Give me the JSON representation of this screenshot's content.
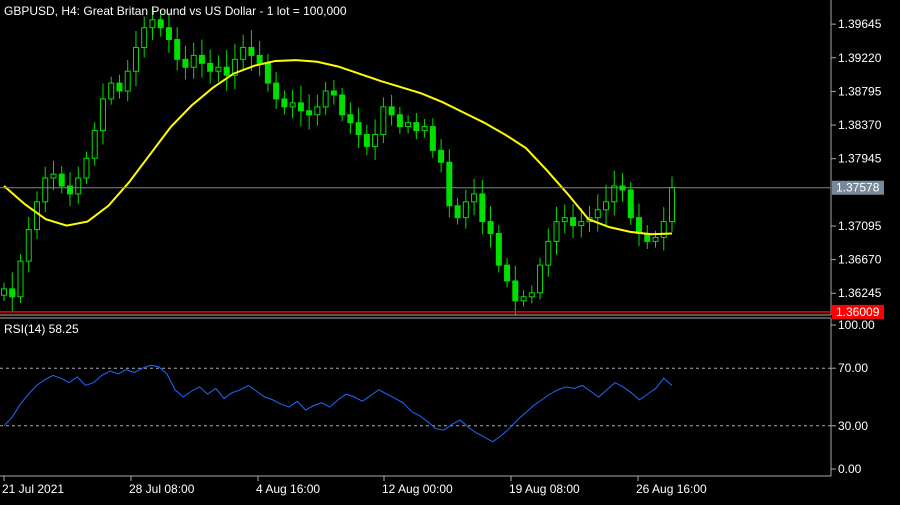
{
  "header": {
    "symbol_title": "GBPUSD, H4:  Great Britan Pound vs US Dollar - 1 lot = 100,000"
  },
  "colors": {
    "background": "#000000",
    "candle": "#00e000",
    "ma_line": "#ffff00",
    "rsi_line": "#1e6bff",
    "bid_line": "#778899",
    "alert_line": "#ff0000",
    "text": "#ffffff",
    "grid": "#aaaaaa"
  },
  "chart_data": [
    {
      "type": "candlestick",
      "title": "GBPUSD, H4:  Great Britan Pound vs US Dollar - 1 lot = 100,000",
      "ylim": [
        1.3597,
        1.3995
      ],
      "y_ticks": [
        "1.39645",
        "1.39220",
        "1.38795",
        "1.38370",
        "1.37945",
        "1.37095",
        "1.36670",
        "1.36245"
      ],
      "x_ticks": [
        "21 Jul 2021",
        "28 Jul 08:00",
        "4 Aug 16:00",
        "12 Aug 00:00",
        "19 Aug 08:00",
        "26 Aug 16:00"
      ],
      "current_price": "1.37578",
      "alert_price": "1.36009",
      "close_series": [
        1.363,
        1.362,
        1.3665,
        1.3705,
        1.374,
        1.377,
        1.3775,
        1.376,
        1.375,
        1.377,
        1.3795,
        1.383,
        1.387,
        1.389,
        1.388,
        1.3905,
        1.3935,
        1.396,
        1.397,
        1.396,
        1.3945,
        1.392,
        1.391,
        1.3925,
        1.3915,
        1.3905,
        1.391,
        1.39,
        1.392,
        1.3935,
        1.3925,
        1.3915,
        1.389,
        1.387,
        1.386,
        1.3865,
        1.3855,
        1.385,
        1.386,
        1.388,
        1.3875,
        1.385,
        1.384,
        1.3825,
        1.381,
        1.3825,
        1.386,
        1.385,
        1.3835,
        1.384,
        1.383,
        1.3835,
        1.3805,
        1.379,
        1.3735,
        1.372,
        1.374,
        1.375,
        1.3715,
        1.37,
        1.366,
        1.364,
        1.3615,
        1.362,
        1.3625,
        1.366,
        1.369,
        1.3715,
        1.372,
        1.371,
        1.3715,
        1.372,
        1.373,
        1.374,
        1.376,
        1.3755,
        1.372,
        1.37,
        1.369,
        1.3695,
        1.3715,
        1.3758
      ],
      "ma_series": [
        1.376,
        1.3737,
        1.3718,
        1.371,
        1.3715,
        1.3735,
        1.3765,
        1.38,
        1.3835,
        1.3862,
        1.3884,
        1.3902,
        1.3912,
        1.3918,
        1.3919,
        1.3917,
        1.3911,
        1.3902,
        1.3893,
        1.3885,
        1.3877,
        1.3866,
        1.3853,
        1.384,
        1.3825,
        1.3808,
        1.378,
        1.375,
        1.3718,
        1.3708,
        1.3702,
        1.3699,
        1.37
      ]
    },
    {
      "type": "line",
      "title": "RSI(14) 58.25",
      "ylim": [
        0,
        100
      ],
      "y_ticks": [
        "100.00",
        "70.00",
        "30.00",
        "0.00"
      ],
      "levels": [
        70,
        30
      ],
      "series": [
        {
          "name": "RSI(14)",
          "values": [
            30,
            36,
            45,
            52,
            58,
            62,
            65,
            63,
            60,
            64,
            58,
            60,
            65,
            68,
            66,
            69,
            67,
            70,
            72,
            71,
            66,
            55,
            50,
            54,
            57,
            52,
            56,
            49,
            53,
            55,
            58,
            54,
            50,
            48,
            45,
            43,
            47,
            41,
            44,
            46,
            43,
            48,
            52,
            50,
            47,
            51,
            55,
            52,
            49,
            46,
            40,
            37,
            33,
            28,
            27,
            31,
            34,
            29,
            25,
            22,
            19,
            23,
            28,
            34,
            39,
            44,
            48,
            52,
            55,
            57,
            56,
            58,
            54,
            50,
            55,
            60,
            57,
            53,
            48,
            52,
            56,
            63,
            58
          ]
        }
      ]
    }
  ]
}
